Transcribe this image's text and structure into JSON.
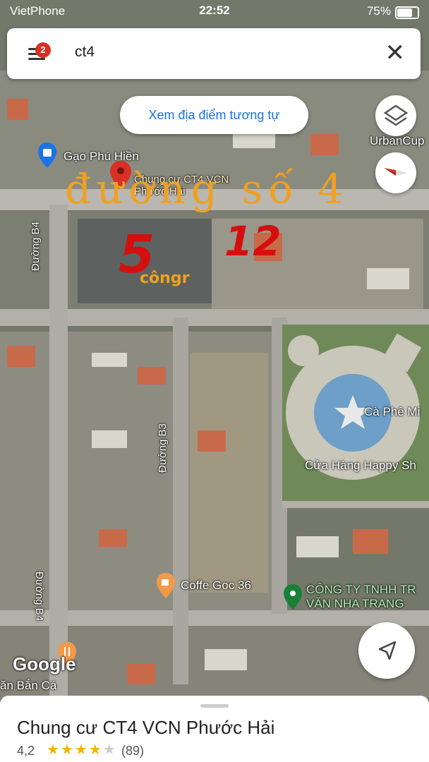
{
  "status_bar": {
    "carrier": "VietPhone",
    "time": "22:52",
    "battery": "75%"
  },
  "search": {
    "badge_count": "2",
    "query": "ct4"
  },
  "similar_chip": {
    "label": "Xem địa điểm tương tự"
  },
  "map_labels": {
    "gao_phu_hien": "Gạo Phú Hiền",
    "chung_cu_line1": "Chung cư CT4 VCN",
    "chung_cu_line2": "Phước Hải",
    "urbancup": "UrbanCup",
    "duong_b4_top": "Đường B4",
    "duong_b3": "Đường B3",
    "duong_b4_bottom": "Đường B4",
    "ca_phe": "Cà Phê Mi",
    "cua_hang": "Cửa Hàng Happy Sh",
    "coffe_goc": "Coffe Goc 36",
    "cong_ty_line1": "CÔNG TY TNHH TR",
    "cong_ty_line2": "VĂN NHA TRANG",
    "google": "Google",
    "ban_ca": "ăn Bắn Cá"
  },
  "handwritten": {
    "street": "đường số 4",
    "num5": "5",
    "num12": "12",
    "cong": "côngr"
  },
  "place_sheet": {
    "name": "Chung cư CT4 VCN Phước Hải",
    "rating": "4,2",
    "reviews": "(89)",
    "stars_filled": 4,
    "stars_total": 5
  },
  "colors": {
    "accent": "#1a73e8",
    "pin": "#d93025",
    "star": "#f4b400",
    "handwriting_orange": "#f0a020",
    "handwriting_red": "#d4100f"
  }
}
